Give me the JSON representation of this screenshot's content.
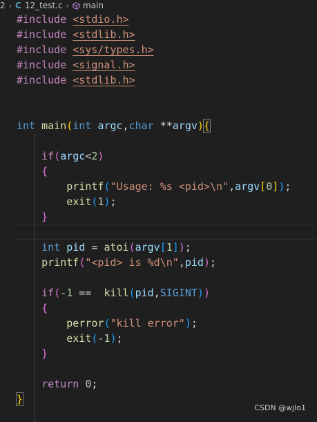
{
  "breadcrumb": {
    "prefix": "2",
    "file_icon": "C",
    "file_name": "12_test.c",
    "symbol_icon": "symbol-method-icon",
    "symbol_name": "main"
  },
  "code": {
    "lines": [
      "#include <stdio.h>",
      "#include <stdlib.h>",
      "#include <sys/types.h>",
      "#include <signal.h>",
      "#include <stdlib.h>",
      "",
      "",
      "int main(int argc,char **argv){",
      "",
      "    if(argc<2)",
      "    {",
      "        printf(\"Usage: %s <pid>\\n\",argv[0]);",
      "        exit(1);",
      "    }",
      "",
      "    int pid = atoi(argv[1]);",
      "    printf(\"<pid> is %d\\n\",pid);",
      "",
      "    if(-1 ==  kill(pid,SIGINT))",
      "    {",
      "        perror(\"kill error\");",
      "        exit(-1);",
      "    }",
      "",
      "    return 0;",
      "}"
    ]
  },
  "tokens": {
    "include": "#include",
    "h1": "<stdio.h>",
    "h2": "<stdlib.h>",
    "h3": "<sys/types.h>",
    "h4": "<signal.h>",
    "h5": "<stdlib.h>",
    "int": "int",
    "main": "main",
    "char": "char",
    "argc": "argc",
    "argv": "argv",
    "if": "if",
    "printf": "printf",
    "usage_str": "\"Usage: %s <pid>\\n\"",
    "zero": "0",
    "one": "1",
    "neg_one": "-1",
    "exit": "exit",
    "pid": "pid",
    "atoi": "atoi",
    "pid_str": "\"<pid> is %d\\n\"",
    "kill": "kill",
    "sigint": "SIGINT",
    "perror": "perror",
    "err_str": "\"kill error\"",
    "return": "return",
    "two": "2"
  },
  "watermark": "CSDN @wjlo1"
}
